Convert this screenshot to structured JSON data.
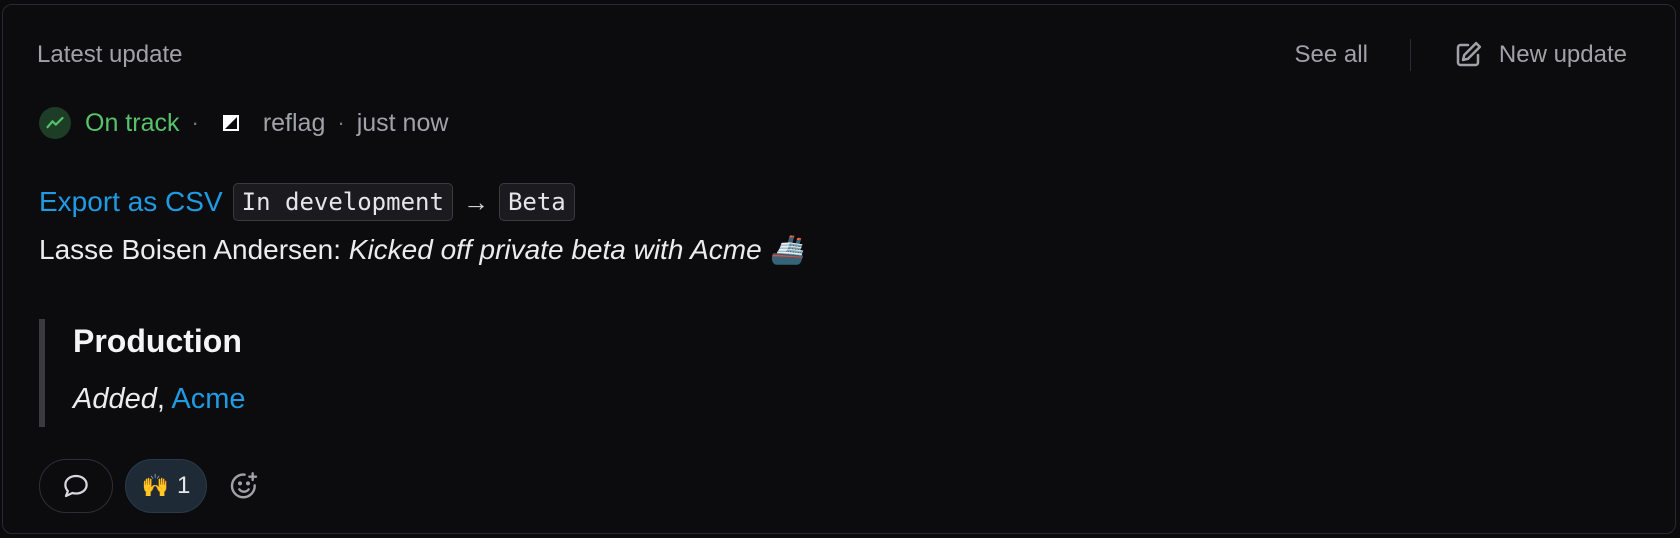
{
  "header": {
    "title": "Latest update",
    "see_all_label": "See all",
    "new_update_label": "New update"
  },
  "status": {
    "label": "On track",
    "separator": "·",
    "author": "reflag",
    "time": "just now",
    "color": "#56c26a"
  },
  "update": {
    "feature_link": "Export as CSV",
    "from_stage": "In development",
    "arrow": "→",
    "to_stage": "Beta",
    "author_prefix": "Lasse Boisen Andersen: ",
    "message": "Kicked off private beta with Acme 🚢"
  },
  "section": {
    "title": "Production",
    "added_label": "Added",
    "comma": ", ",
    "company_link": "Acme"
  },
  "reactions": {
    "comment_icon": "comment-icon",
    "emoji": "🙌",
    "count": "1",
    "add_icon": "add-reaction-icon"
  },
  "colors": {
    "accent_link": "#1e9be3",
    "background": "#0c0c0f"
  }
}
